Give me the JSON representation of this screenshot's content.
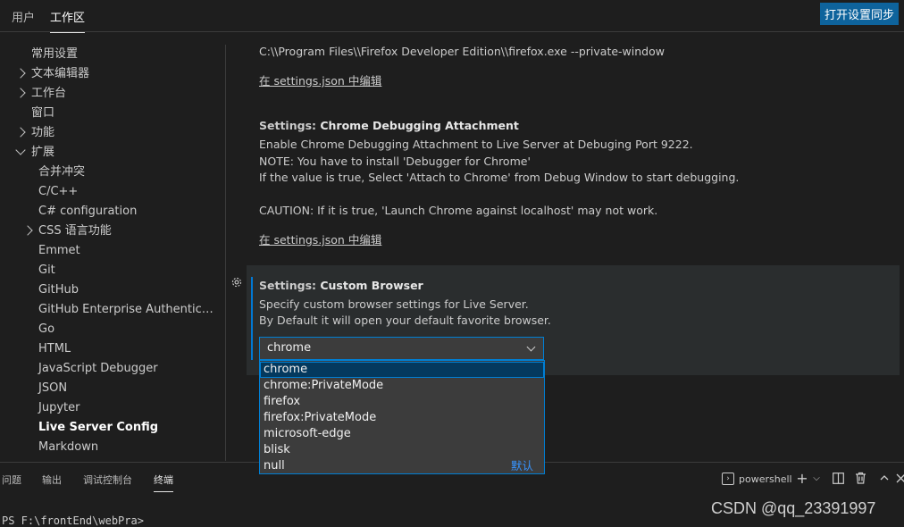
{
  "header": {
    "tabs": [
      {
        "label": "用户",
        "active": false
      },
      {
        "label": "工作区",
        "active": true
      }
    ],
    "sync_button": "打开设置同步"
  },
  "toc": {
    "items": [
      {
        "label": "常用设置",
        "level": 0,
        "expand": "none"
      },
      {
        "label": "文本编辑器",
        "level": 0,
        "expand": "collapsed"
      },
      {
        "label": "工作台",
        "level": 0,
        "expand": "collapsed"
      },
      {
        "label": "窗口",
        "level": 0,
        "expand": "none"
      },
      {
        "label": "功能",
        "level": 0,
        "expand": "collapsed"
      },
      {
        "label": "扩展",
        "level": 0,
        "expand": "expanded"
      },
      {
        "label": "合并冲突",
        "level": 1,
        "expand": "none"
      },
      {
        "label": "C/C++",
        "level": 1,
        "expand": "none"
      },
      {
        "label": "C# configuration",
        "level": 1,
        "expand": "none"
      },
      {
        "label": "CSS 语言功能",
        "level": 1,
        "expand": "collapsed"
      },
      {
        "label": "Emmet",
        "level": 1,
        "expand": "none"
      },
      {
        "label": "Git",
        "level": 1,
        "expand": "none"
      },
      {
        "label": "GitHub",
        "level": 1,
        "expand": "none"
      },
      {
        "label": "GitHub Enterprise Authentication ...",
        "level": 1,
        "expand": "none"
      },
      {
        "label": "Go",
        "level": 1,
        "expand": "none"
      },
      {
        "label": "HTML",
        "level": 1,
        "expand": "none"
      },
      {
        "label": "JavaScript Debugger",
        "level": 1,
        "expand": "none"
      },
      {
        "label": "JSON",
        "level": 1,
        "expand": "none"
      },
      {
        "label": "Jupyter",
        "level": 1,
        "expand": "none"
      },
      {
        "label": "Live Server Config",
        "level": 1,
        "expand": "none",
        "bold": true
      },
      {
        "label": "Markdown",
        "level": 1,
        "expand": "none"
      }
    ]
  },
  "content": {
    "prev_value": "C:\\\\Program Files\\\\Firefox Developer Edition\\\\firefox.exe --private-window",
    "edit_link_1": "在 settings.json 中编辑",
    "chrome_attach": {
      "category": "Settings: ",
      "name": "Chrome Debugging Attachment",
      "desc": [
        "Enable Chrome Debugging Attachment to Live Server at Debuging Port 9222.",
        "NOTE: You have to install 'Debugger for Chrome'",
        "If the value is true, Select 'Attach to Chrome' from Debug Window to start debugging.",
        "CAUTION: If it is true, 'Launch Chrome against localhost' may not work."
      ],
      "edit_link": "在 settings.json 中编辑"
    },
    "custom_browser": {
      "category": "Settings: ",
      "name": "Custom Browser",
      "desc": [
        "Specify custom browser settings for Live Server.",
        "By Default it will open your default favorite browser."
      ],
      "selected": "chrome",
      "options": [
        "chrome",
        "chrome:PrivateMode",
        "firefox",
        "firefox:PrivateMode",
        "microsoft-edge",
        "blisk",
        "null"
      ],
      "default_label": "默认"
    }
  },
  "panel": {
    "tabs": [
      {
        "label": "问题",
        "active": false
      },
      {
        "label": "输出",
        "active": false
      },
      {
        "label": "调试控制台",
        "active": false
      },
      {
        "label": "终端",
        "active": true
      }
    ],
    "terminal_name": "powershell",
    "prompt": "PS F:\\frontEnd\\webPra>"
  },
  "watermark": "CSDN @qq_23391997",
  "colors": {
    "accent": "#007fd4",
    "sync_button": "#0e639c",
    "default_badge": "#3794ff"
  }
}
